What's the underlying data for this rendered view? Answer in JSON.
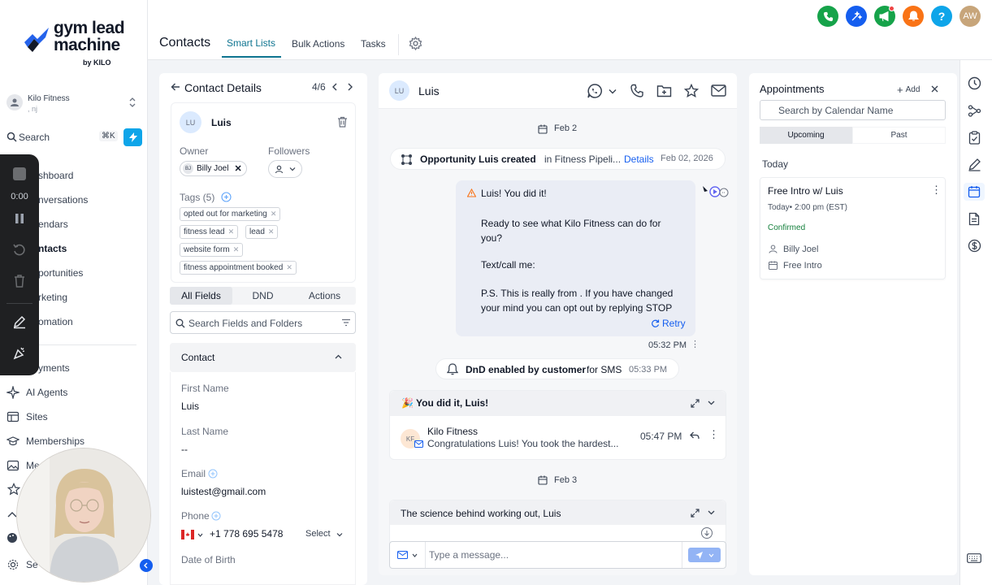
{
  "logo": {
    "line1": "gym lead",
    "line2": "machine",
    "by": "by KILO"
  },
  "account": {
    "name": "Kilo Fitness",
    "sub": ", nj"
  },
  "sidebar": {
    "search_label": "Search",
    "search_shortcut": "⌘K",
    "items": [
      {
        "label": "shboard"
      },
      {
        "label": "nversations"
      },
      {
        "label": "endars"
      },
      {
        "label": "ntacts"
      },
      {
        "label": "portunities"
      },
      {
        "label": "rketing"
      },
      {
        "label": "omation"
      },
      {
        "label": "yments"
      },
      {
        "label": "AI Agents"
      },
      {
        "label": "Sites"
      },
      {
        "label": "Memberships"
      },
      {
        "label": "Me"
      },
      {
        "label": "Se"
      }
    ]
  },
  "recorder": {
    "time": "0:00"
  },
  "topbar": {
    "title": "Contacts",
    "tabs": [
      "Smart Lists",
      "Bulk Actions",
      "Tasks"
    ],
    "avatar": "AW"
  },
  "contact_panel": {
    "title": "Contact Details",
    "pager": "4/6",
    "avatar": "LU",
    "name": "Luis",
    "owner_label": "Owner",
    "followers_label": "Followers",
    "owner_initials": "BJ",
    "owner_name": "Billy Joel",
    "tags_label": "Tags (5)",
    "tags": [
      "opted out for marketing",
      "fitness lead",
      "lead",
      "website form",
      "fitness appointment booked"
    ],
    "tabs": [
      "All Fields",
      "DND",
      "Actions"
    ],
    "search_placeholder": "Search Fields and Folders",
    "section": "Contact",
    "first_name_label": "First Name",
    "first_name": "Luis",
    "last_name_label": "Last Name",
    "last_name": "--",
    "email_label": "Email",
    "email": "luistest@gmail.com",
    "phone_label": "Phone",
    "phone": "+1 778 695 5478",
    "phone_select": "Select",
    "dob_label": "Date of Birth"
  },
  "conversation": {
    "avatar": "LU",
    "name": "Luis",
    "date1": "Feb 2",
    "opp_prefix": "Opportunity Luis created",
    "opp_suffix": "in Fitness Pipeli...",
    "opp_details": "Details",
    "opp_date": "Feb 02, 2026",
    "msg_lines": [
      "Luis! You did it!",
      "Ready to see what Kilo Fitness can do for you?",
      "Text/call me:",
      "P.S. This is really from . If you have changed your mind you can opt out by replying STOP"
    ],
    "retry": "Retry",
    "msg_time": "05:32 PM",
    "dnd_bold": "DnD enabled by customer",
    "dnd_rest": "for SMS",
    "dnd_time": "05:33 PM",
    "email1_subject": "🎉 You did it, Luis!",
    "email1_from": "Kilo Fitness",
    "email1_initials": "KF",
    "email1_preview": "Congratulations Luis! You took the hardest...",
    "email1_time": "05:47 PM",
    "date2": "Feb 3",
    "email2_subject": "The science behind working out, Luis",
    "input_placeholder": "Type a message..."
  },
  "appointments": {
    "title": "Appointments",
    "add": "Add",
    "search_placeholder": "Search by Calendar Name",
    "tabs": [
      "Upcoming",
      "Past"
    ],
    "today": "Today",
    "card_title": "Free Intro w/ Luis",
    "card_time": "Today• 2:00 pm (EST)",
    "status": "Confirmed",
    "assignee": "Billy Joel",
    "calendar": "Free Intro"
  },
  "colors": {
    "accent": "#0e7490",
    "brand_blue": "#155eef",
    "phone_green": "#16a34a",
    "notify_orange": "#f97316",
    "confirmed_green": "#15803d"
  }
}
